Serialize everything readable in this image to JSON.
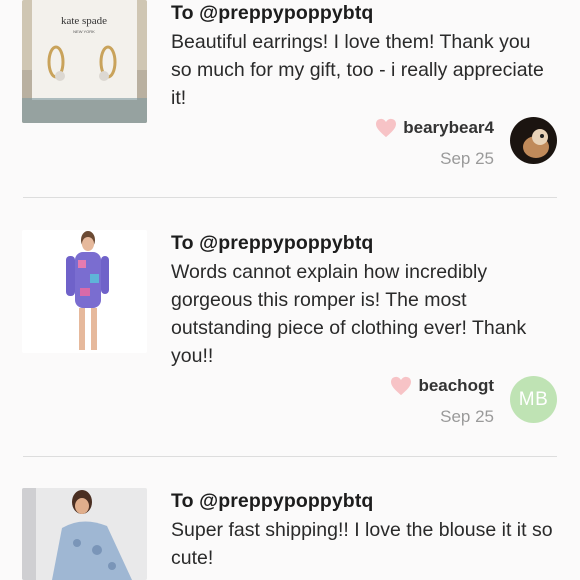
{
  "reviews": [
    {
      "to": "To @preppypoppybtq",
      "text": "Beautiful earrings! I love them! Thank you so much for my gift, too - i really appreciate it!",
      "user": "bearybear4",
      "date": "Sep 25",
      "avatar_initials": "",
      "logo_text": "kate spade",
      "logo_sub": "NEW YORK"
    },
    {
      "to": "To @preppypoppybtq",
      "text": "Words cannot explain how incredibly gorgeous this romper is! The most outstanding piece of clothing ever! Thank you!!",
      "user": "beachogt",
      "date": "Sep 25",
      "avatar_initials": "MB"
    },
    {
      "to": "To @preppypoppybtq",
      "text": "Super fast shipping!! I love the blouse it it so cute!"
    }
  ],
  "colors": {
    "heart": "#f7c3c6",
    "avatar_green": "#bfe3b4",
    "divider": "#dddddd"
  }
}
